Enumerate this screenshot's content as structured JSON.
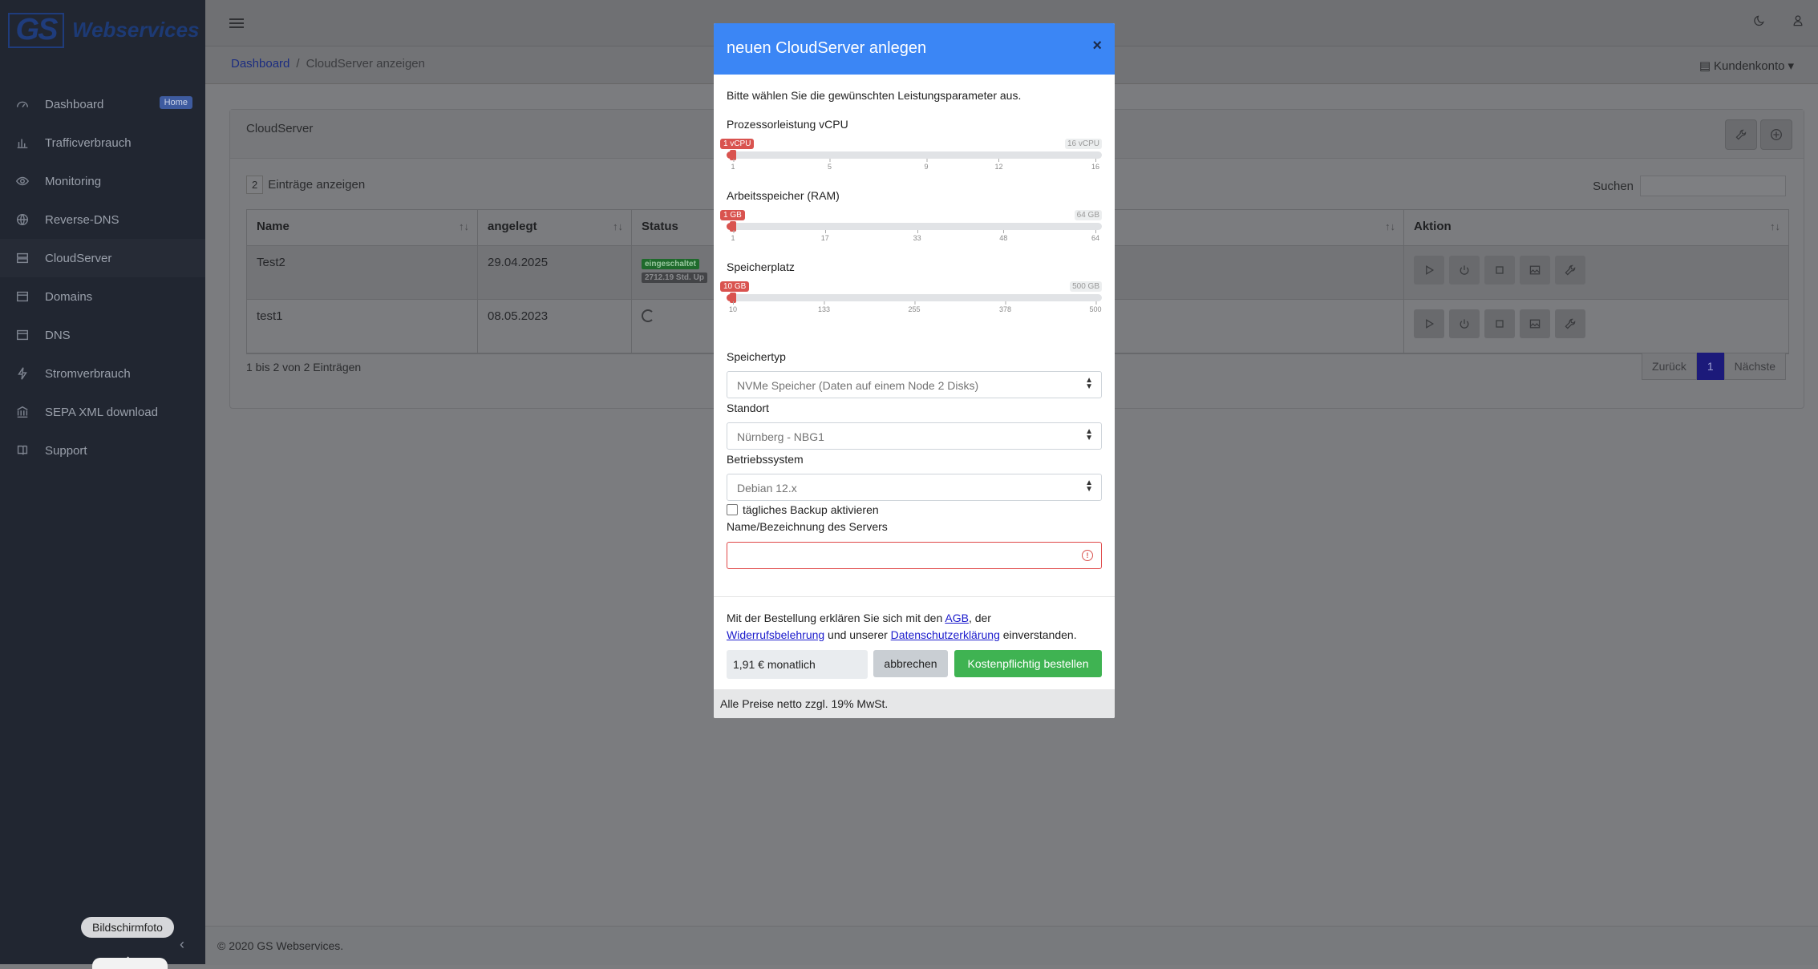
{
  "sidebar": {
    "logo_initials": "GS",
    "logo_text": "Webservices",
    "items": [
      {
        "label": "Dashboard",
        "icon": "speedometer-icon",
        "badge": "Home"
      },
      {
        "label": "Trafficverbrauch",
        "icon": "bar-chart-icon"
      },
      {
        "label": "Monitoring",
        "icon": "eye-icon"
      },
      {
        "label": "Reverse-DNS",
        "icon": "globe-icon"
      },
      {
        "label": "CloudServer",
        "icon": "server-icon"
      },
      {
        "label": "Domains",
        "icon": "window-icon"
      },
      {
        "label": "DNS",
        "icon": "window-icon"
      },
      {
        "label": "Stromverbrauch",
        "icon": "lightning-icon"
      },
      {
        "label": "SEPA XML download",
        "icon": "bank-icon"
      },
      {
        "label": "Support",
        "icon": "book-icon"
      }
    ],
    "tooltip": "Bildschirmfoto"
  },
  "header": {
    "breadcrumb": {
      "root": "Dashboard",
      "separator": "/",
      "current": "CloudServer anzeigen"
    },
    "account": "Kundenkonto"
  },
  "card": {
    "title": "CloudServer",
    "entries_value": "2",
    "entries_label": "Einträge anzeigen",
    "search_label": "Suchen",
    "columns": [
      "Name",
      "angelegt",
      "Status",
      "Aktion"
    ],
    "rows": [
      {
        "name": "Test2",
        "date": "29.04.2025",
        "status_badge": "eingeschaltet",
        "uptime": "2712.19 Std. Up"
      },
      {
        "name": "test1",
        "date": "08.05.2023"
      }
    ],
    "info": "1 bis 2 von 2 Einträgen",
    "pager": {
      "prev": "Zurück",
      "page": "1",
      "next": "Nächste"
    }
  },
  "footer": "© 2020 GS Webservices.",
  "modal": {
    "title": "neuen CloudServer anlegen",
    "close": "×",
    "intro": "Bitte wählen Sie die gewünschten Leistungsparameter aus.",
    "sliders": [
      {
        "label": "Prozessorleistung vCPU",
        "value_label": "1 vCPU",
        "max_label": "16 vCPU",
        "min": 1,
        "max": 16,
        "value": 1,
        "ticks": [
          "1",
          "5",
          "9",
          "12",
          "16"
        ]
      },
      {
        "label": "Arbeitsspeicher (RAM)",
        "value_label": "1 GB",
        "max_label": "64 GB",
        "min": 1,
        "max": 64,
        "value": 1,
        "ticks": [
          "1",
          "17",
          "33",
          "48",
          "64"
        ]
      },
      {
        "label": "Speicherplatz",
        "value_label": "10 GB",
        "max_label": "500 GB",
        "min": 10,
        "max": 500,
        "value": 10,
        "ticks": [
          "10",
          "133",
          "255",
          "378",
          "500"
        ]
      }
    ],
    "storage_type": {
      "label": "Speichertyp",
      "value": "NVMe Speicher (Daten auf einem Node 2 Disks)"
    },
    "location": {
      "label": "Standort",
      "value": "Nürnberg - NBG1"
    },
    "os": {
      "label": "Betriebssystem",
      "value": "Debian 12.x"
    },
    "backup": {
      "label": "tägliches Backup aktivieren",
      "checked": false
    },
    "server_name": {
      "label": "Name/Bezeichnung des Servers",
      "value": ""
    },
    "terms": {
      "prefix": "Mit der Bestellung erklären Sie sich mit den ",
      "agb": "AGB",
      "mid1": ", der",
      "withdrawal": "Widerrufsbelehrung",
      "mid2": " und unserer ",
      "privacy": "Datenschutzerklärung",
      "suffix": " einverstanden."
    },
    "price": "1,91 € monatlich",
    "cancel": "abbrechen",
    "order": "Kostenpflichtig bestellen",
    "footnote": "Alle Preise netto zzgl. 19% MwSt."
  },
  "colors": {
    "accent": "#3b86f5",
    "danger": "#d9534f",
    "success": "#3fb352",
    "sidebar": "#212631"
  }
}
